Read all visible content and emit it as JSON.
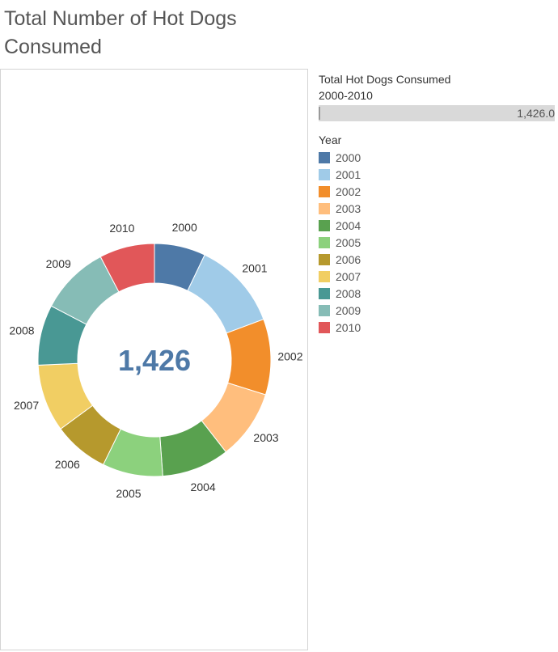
{
  "title": "Total Number of Hot Dogs Consumed",
  "filter": {
    "title": "Total Hot Dogs Consumed",
    "subtitle": "2000-2010",
    "value": "1,426.0"
  },
  "legend": {
    "title": "Year",
    "items": [
      {
        "label": "2000",
        "color": "#4e79a7"
      },
      {
        "label": "2001",
        "color": "#a0cbe8"
      },
      {
        "label": "2002",
        "color": "#f28e2b"
      },
      {
        "label": "2003",
        "color": "#ffbe7d"
      },
      {
        "label": "2004",
        "color": "#59a14f"
      },
      {
        "label": "2005",
        "color": "#8cd17d"
      },
      {
        "label": "2006",
        "color": "#b6992d"
      },
      {
        "label": "2007",
        "color": "#f1ce63"
      },
      {
        "label": "2008",
        "color": "#499894"
      },
      {
        "label": "2009",
        "color": "#86bcb6"
      },
      {
        "label": "2010",
        "color": "#e15759"
      }
    ]
  },
  "chart_data": {
    "type": "pie",
    "donut": true,
    "center_label": "1,426",
    "total": 1426,
    "categories": [
      "2000",
      "2001",
      "2002",
      "2003",
      "2004",
      "2005",
      "2006",
      "2007",
      "2008",
      "2009",
      "2010"
    ],
    "values": [
      50,
      86,
      74,
      68,
      66,
      59,
      54,
      66,
      59,
      68,
      54
    ],
    "colors": [
      "#4e79a7",
      "#a0cbe8",
      "#f28e2b",
      "#ffbe7d",
      "#59a14f",
      "#8cd17d",
      "#b6992d",
      "#f1ce63",
      "#499894",
      "#86bcb6",
      "#e15759"
    ]
  }
}
